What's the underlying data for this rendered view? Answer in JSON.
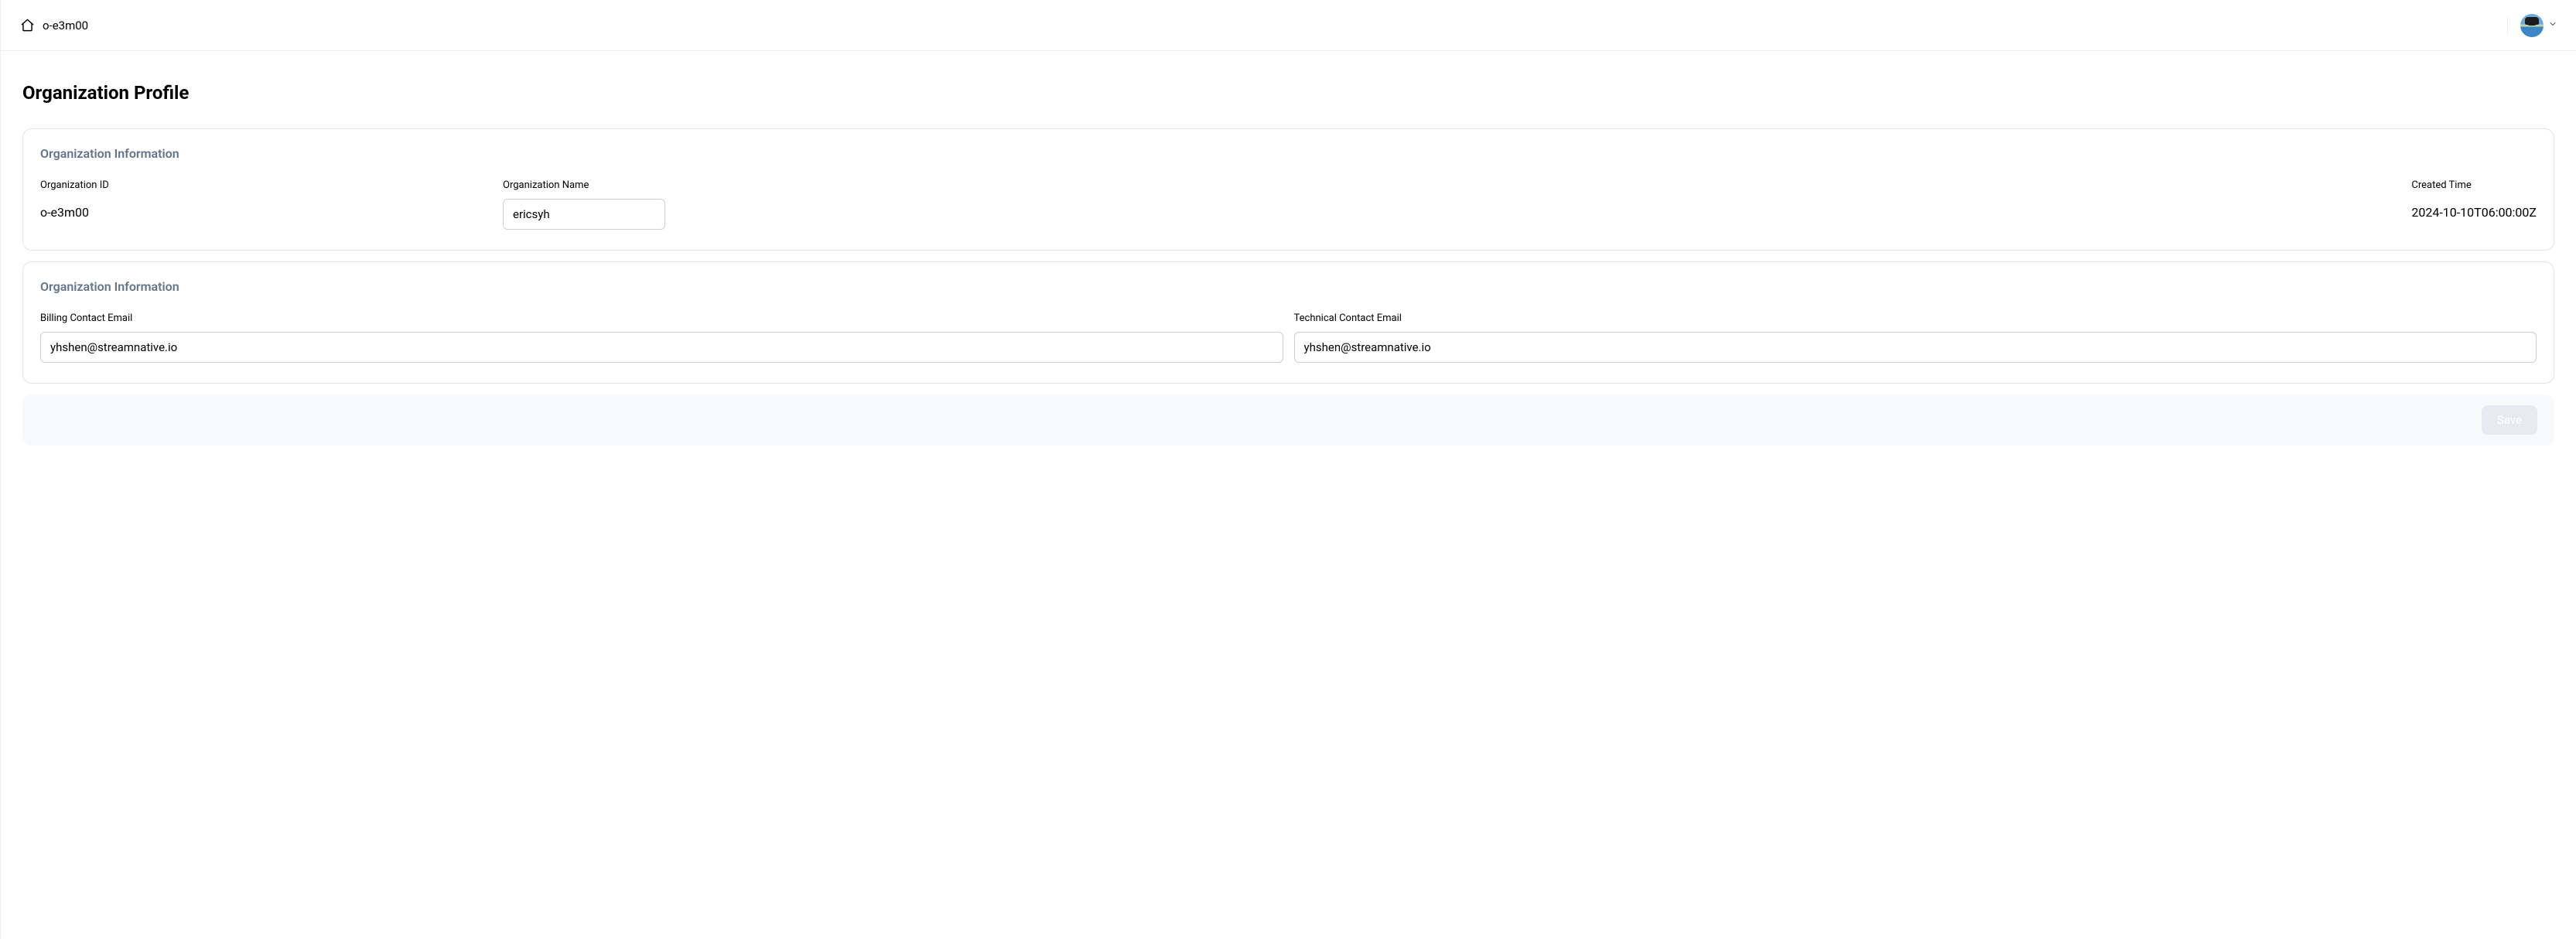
{
  "breadcrumb": {
    "org": "o-e3m00"
  },
  "page": {
    "title": "Organization Profile"
  },
  "section1": {
    "title": "Organization Information",
    "org_id_label": "Organization ID",
    "org_id_value": "o-e3m00",
    "org_name_label": "Organization Name",
    "org_name_value": "ericsyh",
    "created_label": "Created Time",
    "created_value": "2024-10-10T06:00:00Z"
  },
  "section2": {
    "title": "Organization Information",
    "billing_label": "Billing Contact Email",
    "billing_value": "yhshen@streamnative.io",
    "technical_label": "Technical Contact Email",
    "technical_value": "yhshen@streamnative.io"
  },
  "footer": {
    "save_label": "Save"
  }
}
